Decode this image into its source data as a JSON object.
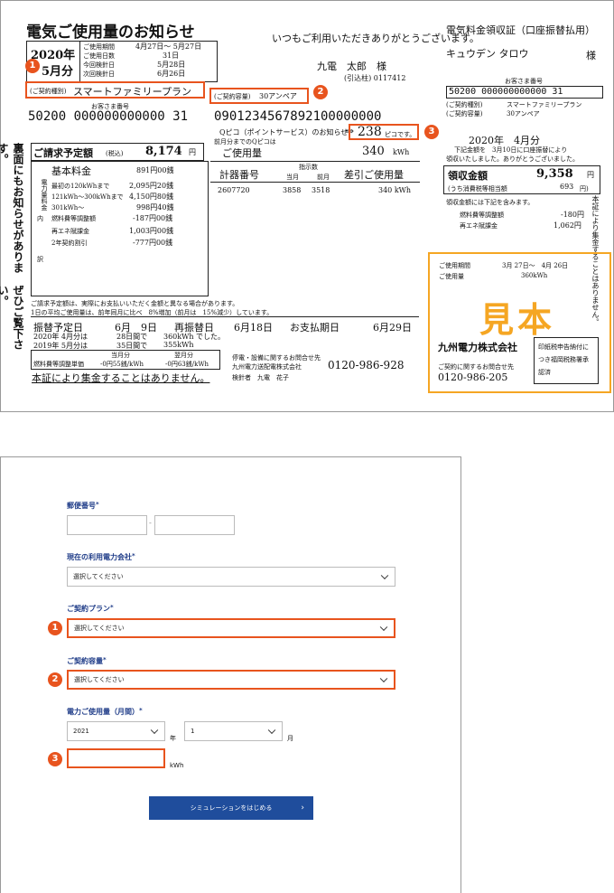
{
  "bill": {
    "title": "電気ご使用量のお知らせ",
    "greeting": "いつもご利用いただきありがとうございます。",
    "year": "2020年",
    "month": "5月分",
    "period_labels": [
      "ご使用期間",
      "ご使用日数",
      "今回検針日",
      "次回検針日"
    ],
    "period_values": [
      "4月27日～ 5月27日",
      "31日",
      "5月28日",
      "6月26日"
    ],
    "customer_name": "九電　太郎　様",
    "customer_id": "(引込柱) 0117412",
    "plan_label": "(ご契約種別)",
    "plan_value": "スマートファミリープラン",
    "capacity_label": "(ご契約容量)",
    "capacity_value": "30アンペア",
    "customer_number_label": "お客さま番号",
    "customer_number": "50200 000000000000 31",
    "supply_point": "0901234567892100000000",
    "qpico_label": "Qピコ（ポイントサービス）のお知らせ",
    "qpico_prev_label": "前月分までのQピコは",
    "qpico_value": "238",
    "qpico_unit": "ピコです。",
    "vertical_notice": "裏面にもお知らせがあります。",
    "vertical_notice2": "ぜひご覧下さい。",
    "billing_label": "ご請求予定額",
    "billing_tax": "(税込)",
    "billing_value": "8,174",
    "billing_unit": "円",
    "usage_label": "ご使用量",
    "usage_value": "340",
    "usage_unit": "kWh",
    "breakdown": [
      {
        "label": "基本料金",
        "value": "891円00銭"
      },
      {
        "label": "最初の120kWhまで",
        "value": "2,095円20銭"
      },
      {
        "label": "121kWh～300kWhまで",
        "value": "4,150円80銭"
      },
      {
        "label": "301kWh～",
        "value": "998円40銭"
      },
      {
        "label": "燃料費等調整額",
        "value": "-187円00銭"
      },
      {
        "label": "再エネ賦課金",
        "value": "1,003円00銭"
      },
      {
        "label": "2年契約割引",
        "value": "-777円00銭"
      }
    ],
    "breakdown_side": [
      "電",
      "力",
      "量",
      "料",
      "金"
    ],
    "breakdown_side2": "内",
    "breakdown_side3": "訳",
    "meter_headers": [
      "計器番号",
      "指示数",
      "当月",
      "前月",
      "差引ご使用量"
    ],
    "meter_values": [
      "2607720",
      "3858",
      "3518",
      "340 kWh"
    ],
    "note1": "ご請求予定額は、実際にお支払いいただく金額と異なる場合があります。",
    "note2": "1日の平均ご使用量は、前年同月に比べ　8%増加（前月は　15%減少）しています。",
    "transfer_label": "振替予定日",
    "transfer_value": "6月　9日",
    "retransfer_label": "再振替日",
    "retransfer_value": "6月18日",
    "due_label": "お支払期日",
    "due_value": "6月29日",
    "history": [
      {
        "year": "2020年 4月分は",
        "days": "28日間で",
        "kwh": "360kWh でした。"
      },
      {
        "year": "2019年 5月分は",
        "days": "35日間で",
        "kwh": "355kWh"
      }
    ],
    "fuel_headers": [
      "当月分",
      "翌月分"
    ],
    "fuel_label": "燃料費等調整単価",
    "fuel_values": [
      "-0円55銭/kWh",
      "-0円63銭/kWh"
    ],
    "contact_label": "停電・設備に関するお問合せ先",
    "contact_company": "九州電力送配電株式会社",
    "contact_phone": "0120-986-928",
    "inspector": "検針者　九電　花子",
    "footer": "本証により集金することはありません。",
    "receipt_title": "電気料金領収証（口座振替払用）",
    "receipt_name": "キュウデン タロウ",
    "receipt_sama": "様",
    "receipt_custno_label": "お客さま番号",
    "receipt_custno": "50200 000000000000 31",
    "receipt_plan_label": "(ご契約種別)",
    "receipt_plan": "スマートファミリープラン",
    "receipt_cap_label": "(ご契約容量)",
    "receipt_cap": "30アンペア",
    "receipt_month": "2020年　4月分",
    "receipt_text1": "下記金額を　3月10日に口座振替により",
    "receipt_text2": "領収いたしました。ありがとうございました。",
    "receipt_amount_label": "領収金額",
    "receipt_amount": "9,358",
    "receipt_amount_unit": "円",
    "receipt_tax_label": "(うち消費税等相当額",
    "receipt_tax": "693",
    "receipt_tax_unit": "円)",
    "receipt_note": "領収金額には下記を含みます。",
    "receipt_fuel_label": "燃料費等調整額",
    "receipt_fuel": "-180円",
    "receipt_renew_label": "再エネ賦課金",
    "receipt_renew": "1,062円",
    "receipt_period_label": "ご使用期間",
    "receipt_period": "3月 27日～　4月 26日",
    "receipt_usage_label": "ご使用量",
    "receipt_usage": "360kWh",
    "stamp": "見本",
    "receipt_company": "九州電力株式会社",
    "receipt_contact": "ご契約に関するお問合せ先",
    "receipt_phone": "0120-986-205",
    "receipt_side": "印紙税申告納付につき福岡税務署承認済",
    "receipt_vertical": "本証により集金することはありません。",
    "badges": [
      "1",
      "2",
      "3"
    ]
  },
  "form": {
    "postal_label": "郵便番号",
    "postal_sep": "-",
    "provider_label": "現在の利用電力会社",
    "provider_value": "選択してください",
    "plan_label": "ご契約プラン",
    "plan_value": "選択してください",
    "capacity_label": "ご契約容量",
    "capacity_value": "選択してください",
    "usage_label": "電力ご使用量（月間）",
    "year_value": "2021",
    "year_unit": "年",
    "month_value": "1",
    "month_unit": "月",
    "kwh_unit": "kWh",
    "required_mark": "*",
    "submit_label": "シミュレーションをはじめる",
    "submit_arrow": "›",
    "badges": [
      "1",
      "2",
      "3"
    ]
  },
  "colors": {
    "accent": "#e8541e",
    "stamp": "#f5a623",
    "primary": "#1f4d9c"
  }
}
